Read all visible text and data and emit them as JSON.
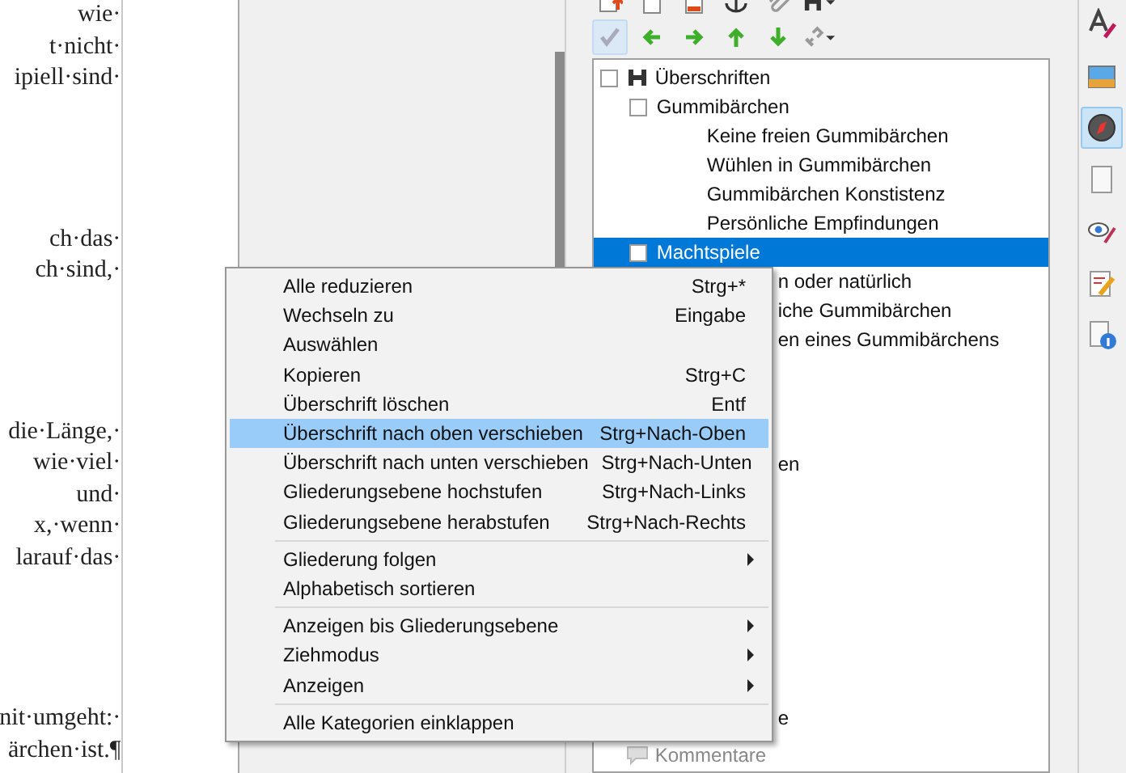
{
  "document": {
    "paragraphs": [
      {
        "lines": [
          "wie·",
          "t·nicht·",
          "ipiell·sind·"
        ]
      },
      {
        "lines": [
          "ch·das·",
          "ch·sind,·"
        ]
      },
      {
        "lines": [
          "die·Länge,·",
          "wie·viel·",
          "und·",
          "x,·wenn·",
          "larauf·das·"
        ]
      },
      {
        "lines": [
          "nit·umgeht:·",
          "ärchen·ist.¶"
        ]
      }
    ]
  },
  "navigator": {
    "toolbar_rows": [
      [
        {
          "kind": "insert"
        },
        {
          "kind": "header"
        },
        {
          "kind": "footer"
        },
        {
          "kind": "anchor"
        },
        {
          "kind": "clip"
        },
        {
          "kind": "heading-menu"
        }
      ],
      [
        {
          "kind": "check",
          "pressed": true
        },
        {
          "kind": "left"
        },
        {
          "kind": "right"
        },
        {
          "kind": "up"
        },
        {
          "kind": "down"
        },
        {
          "kind": "link-menu"
        }
      ]
    ],
    "tree": [
      {
        "label": "Überschriften",
        "kind": "category",
        "expanded": true,
        "selected": false,
        "children": [
          {
            "label": "Gummibärchen",
            "expanded": true,
            "selected": false,
            "children": [
              {
                "label": "Keine freien Gummibärchen",
                "selected": false
              },
              {
                "label": "Wühlen in Gummibärchen",
                "selected": false
              },
              {
                "label": "Gummibärchen Konstistenz",
                "selected": false
              },
              {
                "label": "Persönliche Empfindungen",
                "selected": false
              }
            ]
          },
          {
            "label": "Machtspiele",
            "expanded": true,
            "selected": true,
            "children": [
              {
                "label": "n oder natürlich",
                "kind": "clipped",
                "selected": false
              },
              {
                "label": "iche Gummibärchen",
                "kind": "clipped",
                "selected": false
              },
              {
                "label": "en eines Gummibärchens",
                "kind": "clipped",
                "selected": false
              }
            ]
          }
        ]
      },
      {
        "label": "en",
        "kind": "clipped",
        "selected": false
      },
      {
        "label": "e",
        "kind": "clipped",
        "selected": false
      },
      {
        "label": "Kommentare",
        "kind": "comment",
        "selected": false
      }
    ]
  },
  "sidebar": [
    {
      "kind": "properties",
      "pressed": false
    },
    {
      "kind": "gallery",
      "pressed": false
    },
    {
      "kind": "navigator",
      "pressed": true
    },
    {
      "kind": "page",
      "pressed": false
    },
    {
      "kind": "styles",
      "pressed": false
    },
    {
      "kind": "manage",
      "pressed": false
    },
    {
      "kind": "info",
      "pressed": false
    }
  ],
  "context_menu": {
    "groups": [
      [
        {
          "label": "Alle reduzieren",
          "shortcut": "Strg+*",
          "submenu": false,
          "selected": false
        },
        {
          "label": "Wechseln zu",
          "shortcut": "Eingabe",
          "submenu": false,
          "selected": false
        },
        {
          "label": "Auswählen",
          "submenu": false,
          "selected": false
        },
        {
          "label": "Kopieren",
          "shortcut": "Strg+C",
          "submenu": false,
          "selected": false
        },
        {
          "label": "Überschrift löschen",
          "shortcut": "Entf",
          "submenu": false,
          "selected": false
        },
        {
          "label": "Überschrift nach oben verschieben",
          "shortcut": "Strg+Nach-Oben",
          "submenu": false,
          "selected": true
        },
        {
          "label": "Überschrift nach unten verschieben",
          "shortcut": "Strg+Nach-Unten",
          "submenu": false,
          "selected": false
        },
        {
          "label": "Gliederungsebene hochstufen",
          "shortcut": "Strg+Nach-Links",
          "submenu": false,
          "selected": false
        },
        {
          "label": "Gliederungsebene herabstufen",
          "shortcut": "Strg+Nach-Rechts",
          "submenu": false,
          "selected": false
        }
      ],
      [
        {
          "label": "Gliederung folgen",
          "submenu": true,
          "selected": false
        },
        {
          "label": "Alphabetisch sortieren",
          "submenu": false,
          "selected": false
        }
      ],
      [
        {
          "label": "Anzeigen bis Gliederungsebene",
          "submenu": true,
          "selected": false
        },
        {
          "label": "Ziehmodus",
          "submenu": true,
          "selected": false
        },
        {
          "label": "Anzeigen",
          "submenu": true,
          "selected": false
        }
      ],
      [
        {
          "label": "Alle Kategorien einklappen",
          "submenu": false,
          "selected": false
        }
      ]
    ]
  }
}
